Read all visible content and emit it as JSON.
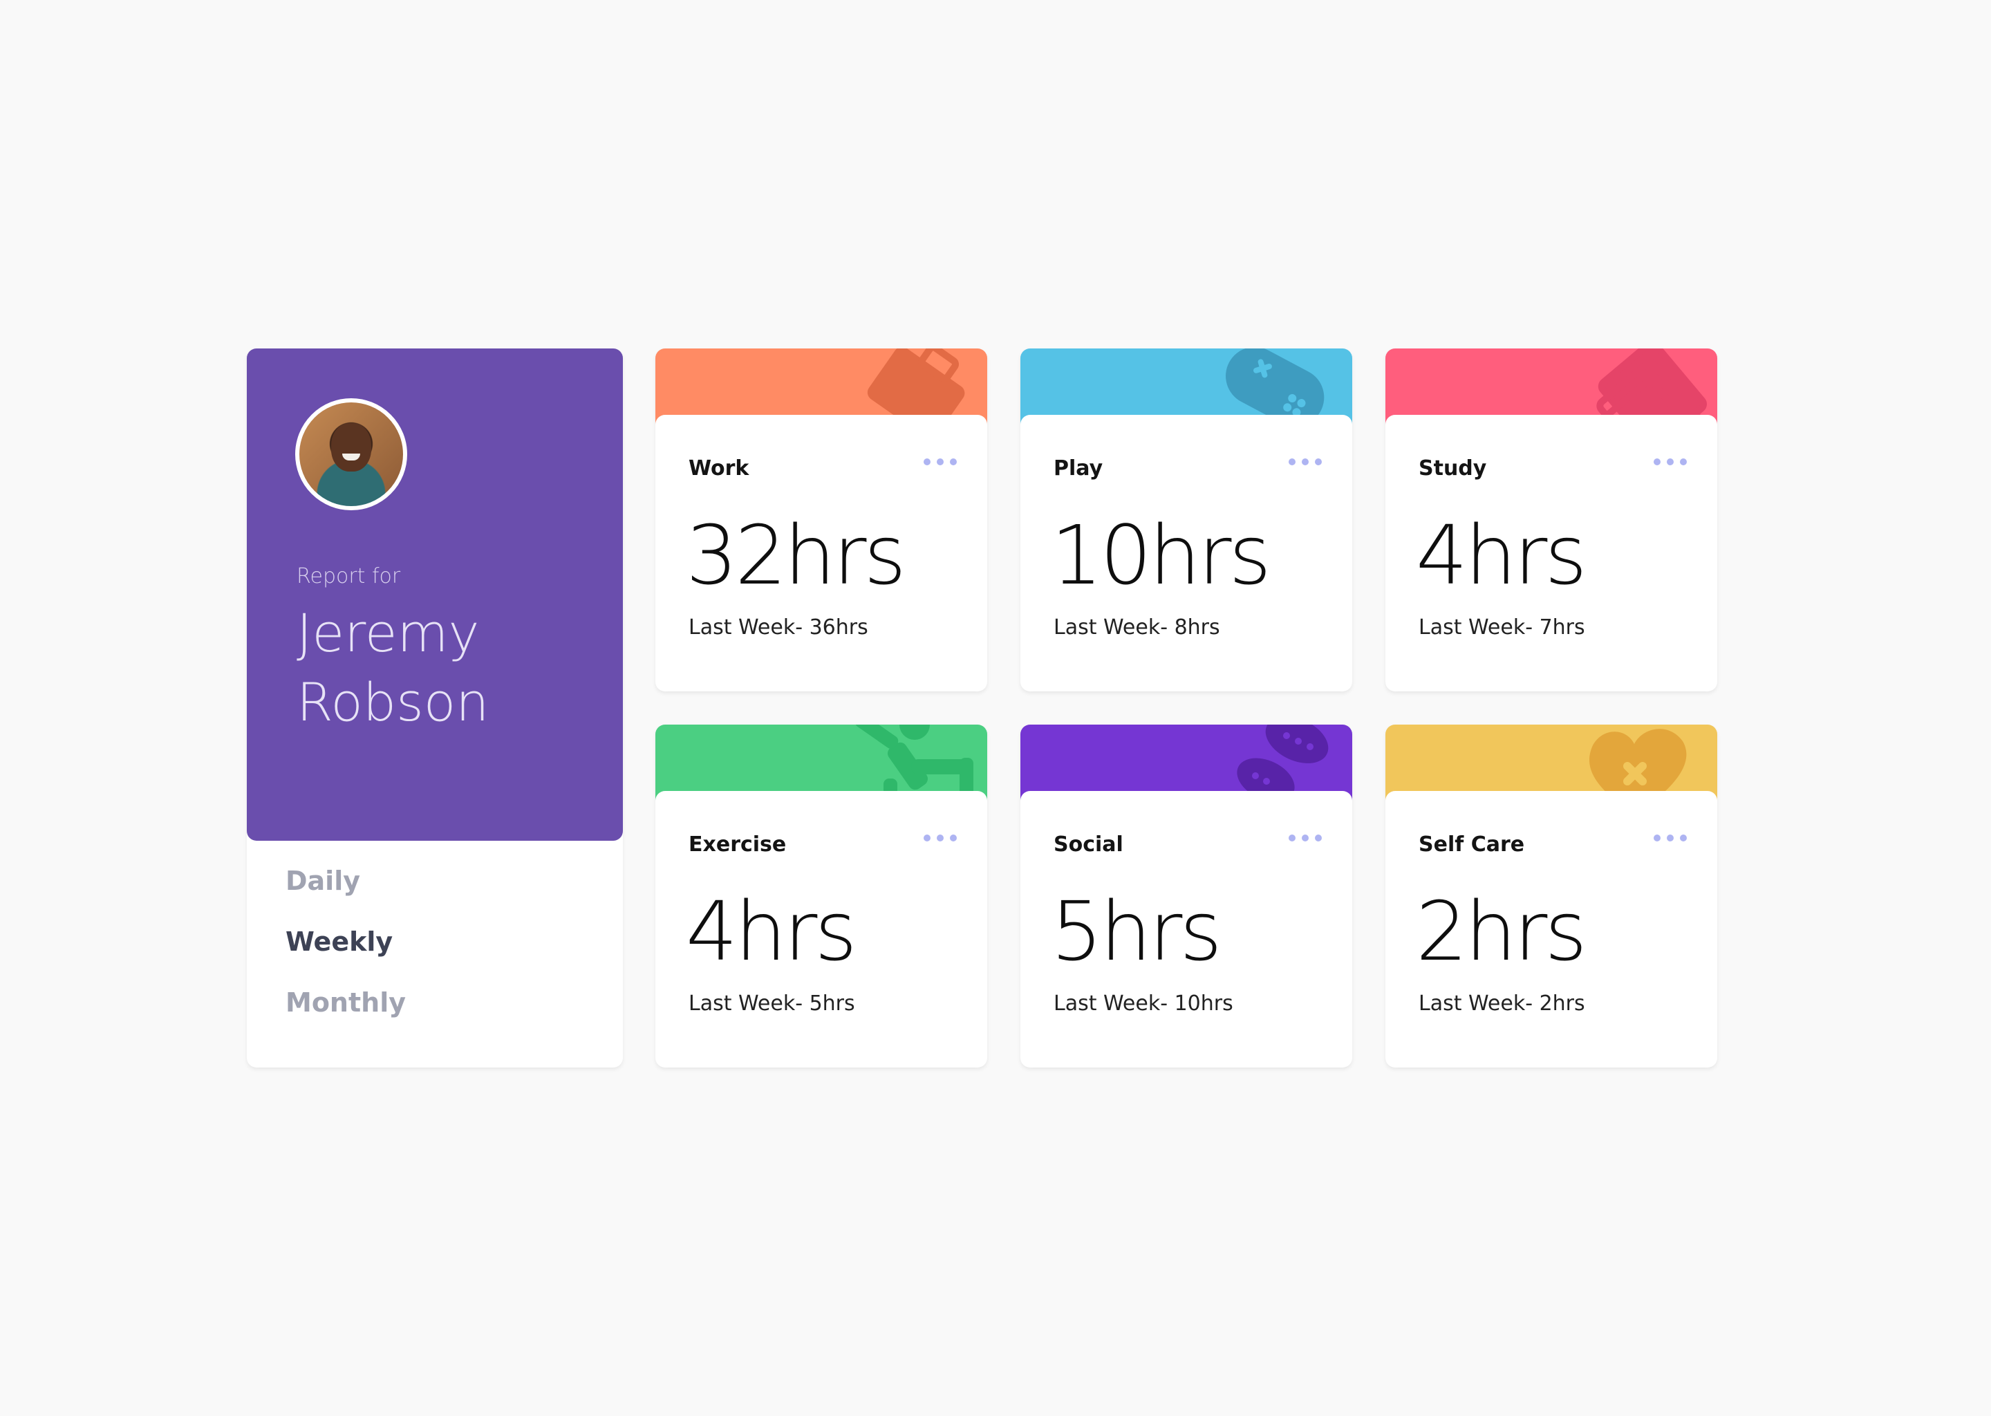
{
  "profile": {
    "report_for": "Report for",
    "name": "Jeremy Robson",
    "avatar_color": "#6a4ead",
    "periods": [
      {
        "label": "Daily",
        "active": false
      },
      {
        "label": "Weekly",
        "active": true
      },
      {
        "label": "Monthly",
        "active": false
      }
    ]
  },
  "cards": [
    {
      "title": "Work",
      "hours": "32hrs",
      "previous": "Last Week- 36hrs",
      "color": "#ff8b64",
      "icon": "briefcase-icon"
    },
    {
      "title": "Play",
      "hours": "10hrs",
      "previous": "Last Week- 8hrs",
      "color": "#55c2e6",
      "icon": "gamepad-icon"
    },
    {
      "title": "Study",
      "hours": "4hrs",
      "previous": "Last Week- 7hrs",
      "color": "#ff5e7d",
      "icon": "book-icon"
    },
    {
      "title": "Exercise",
      "hours": "4hrs",
      "previous": "Last Week- 5hrs",
      "color": "#4bcf82",
      "icon": "running-icon"
    },
    {
      "title": "Social",
      "hours": "5hrs",
      "previous": "Last Week- 10hrs",
      "color": "#7536d3",
      "icon": "chat-bubbles-icon"
    },
    {
      "title": "Self Care",
      "hours": "2hrs",
      "previous": "Last Week- 2hrs",
      "color": "#f1c65b",
      "icon": "heart-bandage-icon"
    }
  ]
}
